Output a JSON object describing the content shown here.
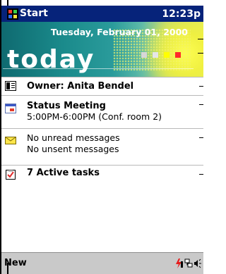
{
  "titlebar": {
    "start_label": "Start",
    "clock": "12:23p",
    "start_icon": "windows-flag-icon"
  },
  "today": {
    "date": "Tuesday, February 01, 2000",
    "word": "today",
    "squares": [
      "#d7d7d7",
      "#e6e6e6",
      "#ffff00",
      "#ff2a2a"
    ]
  },
  "items": [
    {
      "icon": "owner-card-icon",
      "line1": "Owner: Anita Bendel",
      "line2": ""
    },
    {
      "icon": "calendar-icon",
      "line1": "Status Meeting",
      "line2": "5:00PM-6:00PM (Conf. room 2)"
    },
    {
      "icon": "envelope-icon",
      "line1": "No unread messages",
      "line2": "No unsent messages"
    },
    {
      "icon": "task-checkbox-icon",
      "line1": "7 Active tasks",
      "line2": ""
    }
  ],
  "bottombar": {
    "new_label": "New",
    "tray_icons": [
      "power-icon",
      "network-icon",
      "speaker-icon"
    ]
  }
}
